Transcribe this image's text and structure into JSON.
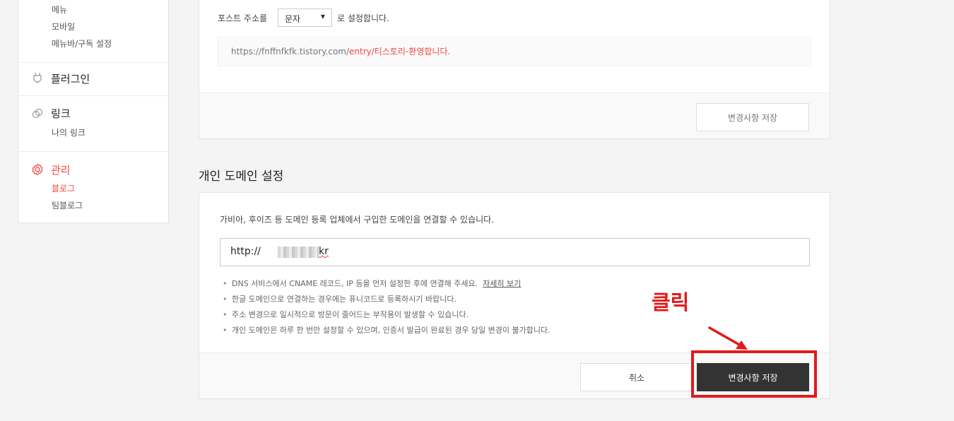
{
  "sidebar": {
    "top_items": [
      "메뉴",
      "모바일",
      "메뉴바/구독 설정"
    ],
    "plugin": {
      "title": "플러그인",
      "icon": "plug-icon"
    },
    "link": {
      "title": "링크",
      "icon": "link-icon",
      "items": [
        "나의 링크"
      ]
    },
    "manage": {
      "title": "관리",
      "icon": "gear-icon",
      "items": [
        "블로그",
        "팀블로그"
      ]
    }
  },
  "post_address": {
    "prefix": "포스트 주소를",
    "select_value": "문자",
    "suffix": "로 설정합니다.",
    "url_base": "https://fnffnfkfk.tistory.com/",
    "url_highlight": "entry/티스토리-환영합니다.",
    "save_label": "변경사항 저장"
  },
  "domain": {
    "heading": "개인 도메인 설정",
    "description": "가비아, 후이즈 등 도메인 등록 업체에서 구입한 도메인을 연결할 수 있습니다.",
    "input_prefix": "http://",
    "input_suffix": "kr",
    "notes": [
      "DNS 서비스에서 CNAME 레코드, IP 등을 먼저 설정한 후에 연결해 주세요.",
      "한글 도메인으로 연결하는 경우에는 퓨니코드로 등록하시기 바랍니다.",
      "주소 변경으로 일시적으로 방문이 줄어드는 부작용이 발생할 수 있습니다.",
      "개인 도메인은 하루 한 번만 설정할 수 있으며, 인증서 발급이 완료된 경우 당일 변경이 불가합니다."
    ],
    "detail_link": "자세히 보기",
    "cancel_label": "취소",
    "save_label": "변경사항 저장"
  },
  "annotation": {
    "text": "클릭",
    "color": "#e21a1a"
  },
  "colors": {
    "accent": "#f0483e",
    "dark_button": "#333333"
  }
}
